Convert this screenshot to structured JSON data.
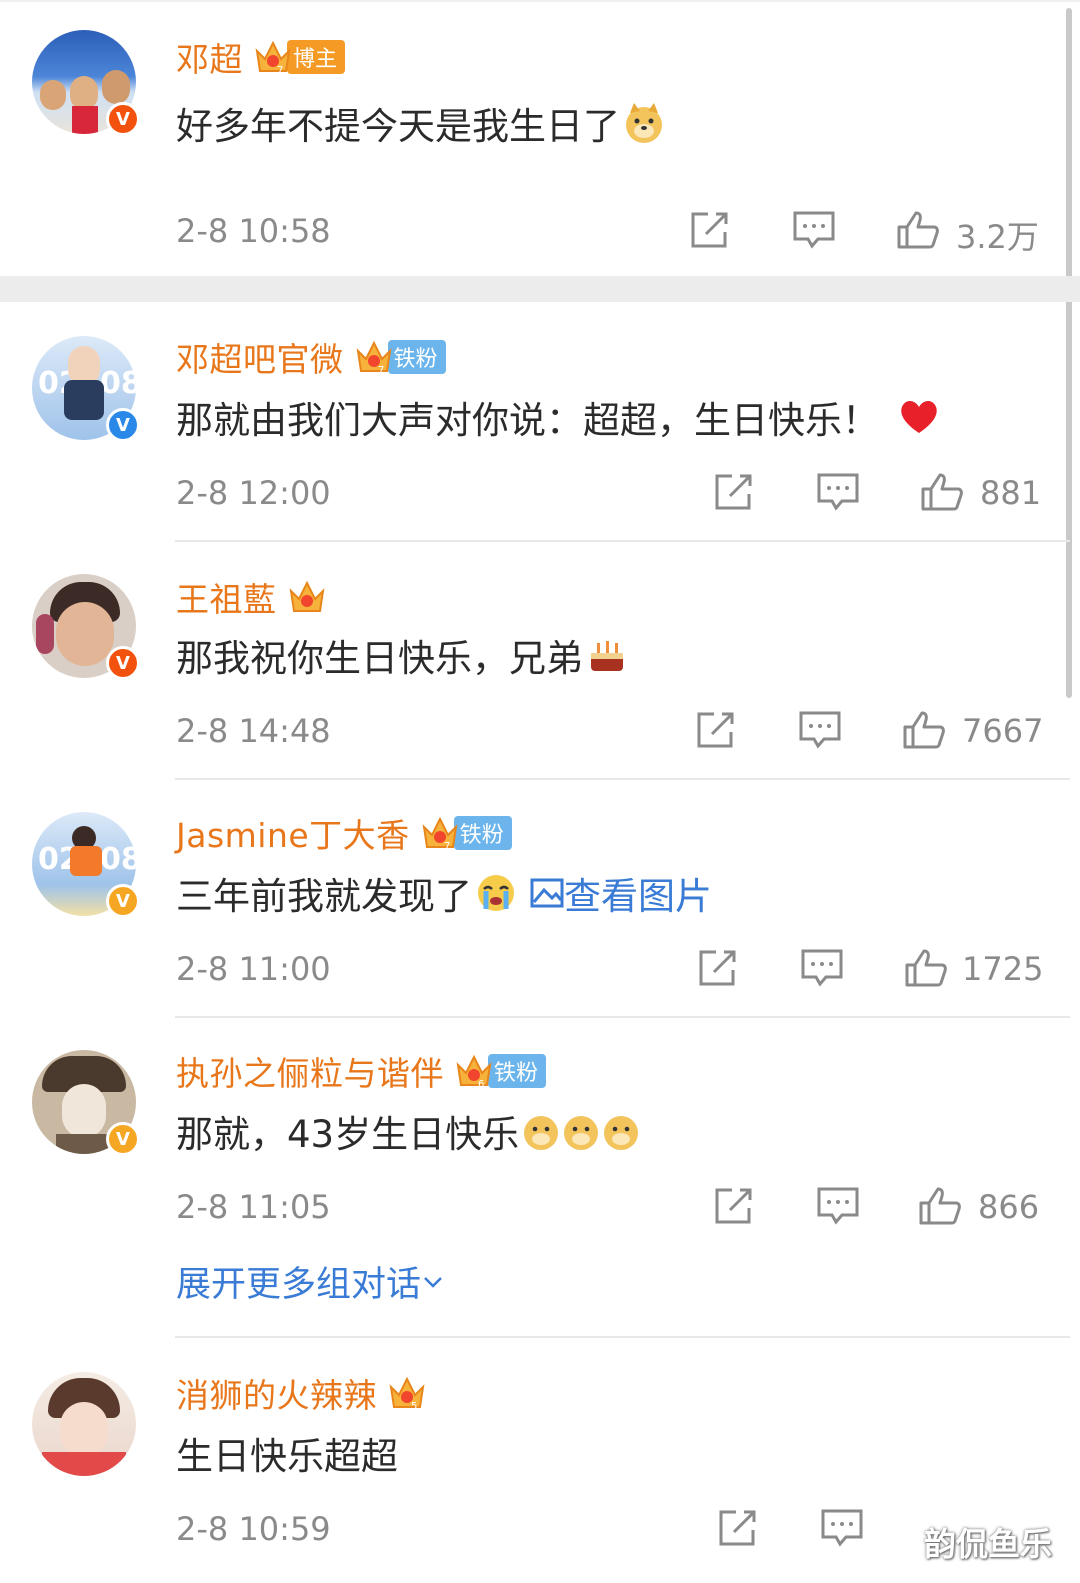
{
  "comments": [
    {
      "username": "邓超",
      "badge": "博主",
      "badge_color": "#f59b25",
      "verify": "red",
      "content": "好多年不提今天是我生日了",
      "emoji": "doge",
      "time": "2-8 10:58",
      "likes": "3.2万"
    },
    {
      "username": "邓超吧官微",
      "badge": "铁粉",
      "badge_color": "#6bb5ec",
      "verify": "blue",
      "content": "那就由我们大声对你说：超超，生日快乐！",
      "emoji": "heart",
      "time": "2-8 12:00",
      "likes": "881"
    },
    {
      "username": "王祖藍",
      "badge": "",
      "verify": "red",
      "content": "那我祝你生日快乐，兄弟",
      "emoji": "cake",
      "time": "2-8 14:48",
      "likes": "7667"
    },
    {
      "username": "Jasmine丁大香",
      "badge": "铁粉",
      "badge_color": "#6bb5ec",
      "verify": "gold",
      "content": "三年前我就发现了",
      "emoji": "cry",
      "link": "查看图片",
      "time": "2-8 11:00",
      "likes": "1725"
    },
    {
      "username": "执孙之俪粒与谐伴",
      "badge": "铁粉",
      "badge_color": "#6bb5ec",
      "verify": "gold",
      "content": "那就，43岁生日快乐",
      "emoji": "doge x3",
      "time": "2-8 11:05",
      "likes": "866",
      "expand": "展开更多组对话"
    },
    {
      "username": "消狮的火辣辣",
      "badge": "",
      "verify": "none",
      "content": "生日快乐超超",
      "time": "2-8 10:59",
      "likes": ""
    }
  ],
  "watermark": "韵侃鱼乐",
  "colors": {
    "username": "#e8771b",
    "link": "#3a7bd5",
    "meta": "#8a8a8a"
  }
}
